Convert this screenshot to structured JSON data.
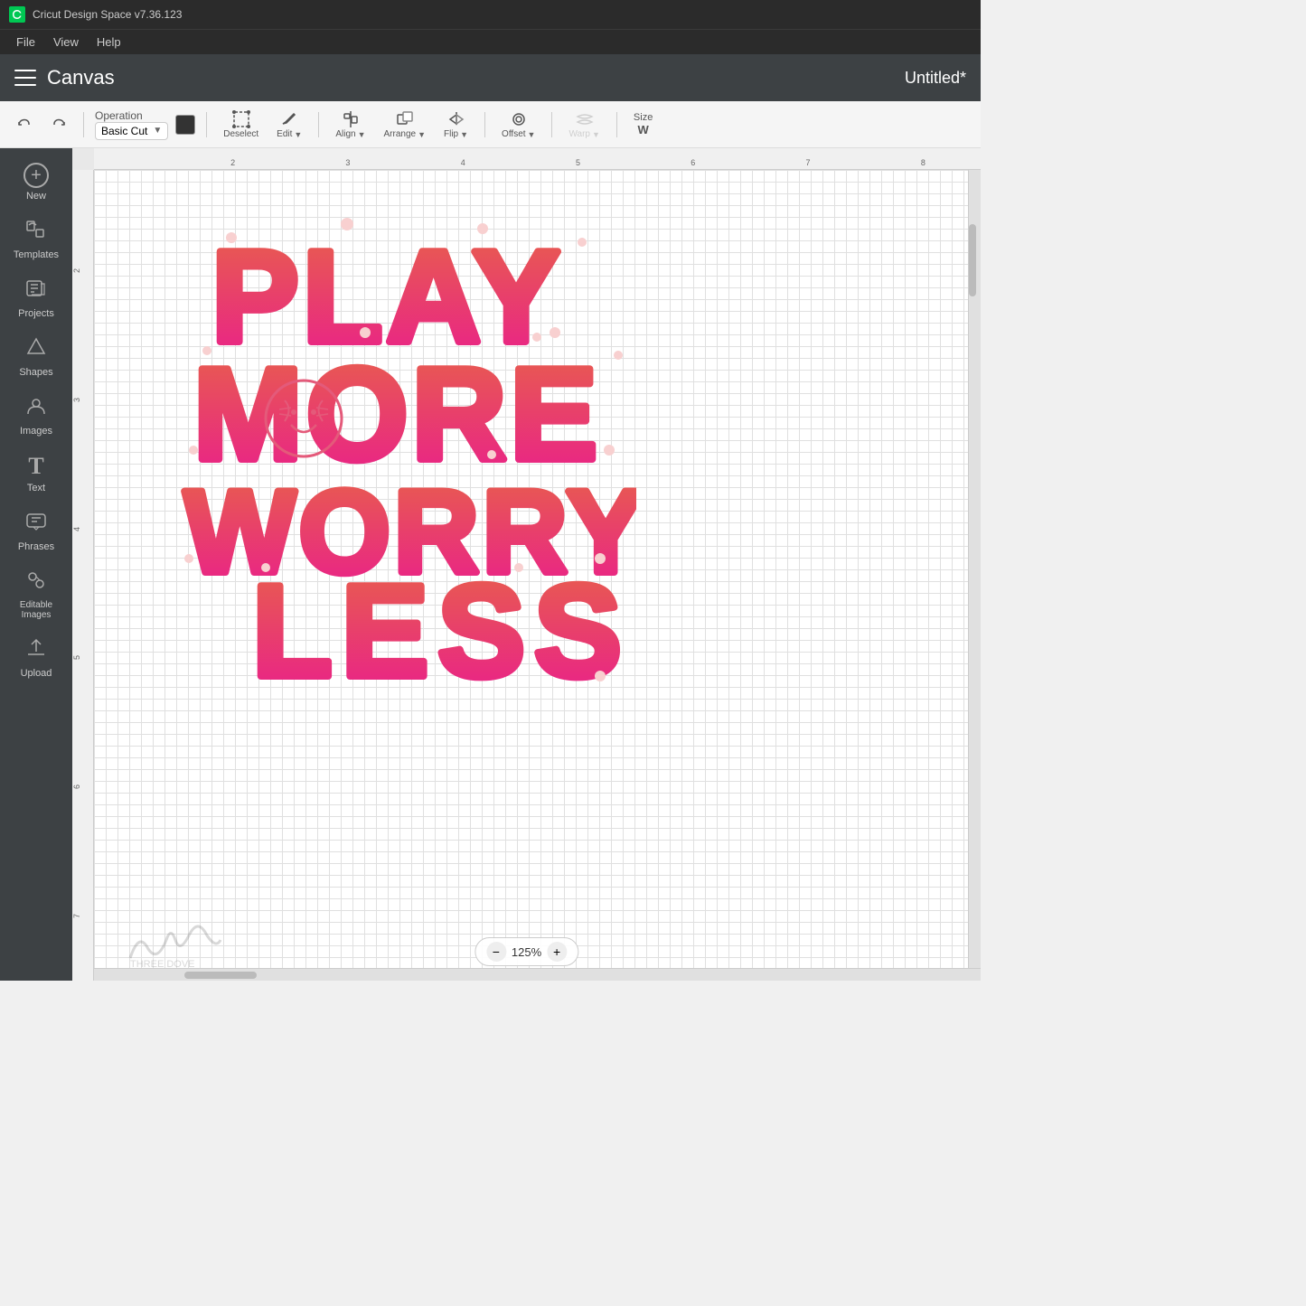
{
  "app": {
    "title": "Cricut Design Space  v7.36.123",
    "logo_text": "C"
  },
  "menu": {
    "items": [
      "File",
      "View",
      "Help"
    ]
  },
  "navbar": {
    "title": "Canvas",
    "doc_title": "Untitled*",
    "hamburger_label": "menu"
  },
  "toolbar": {
    "undo_label": "undo",
    "redo_label": "redo",
    "operation_label": "Operation",
    "operation_value": "Basic Cut",
    "deselect_label": "Deselect",
    "edit_label": "Edit",
    "align_label": "Align",
    "arrange_label": "Arrange",
    "flip_label": "Flip",
    "offset_label": "Offset",
    "warp_label": "Warp",
    "size_label": "Size",
    "size_short": "W"
  },
  "sidebar": {
    "items": [
      {
        "icon": "➕",
        "label": "New"
      },
      {
        "icon": "👕",
        "label": "Templates"
      },
      {
        "icon": "📋",
        "label": "Projects"
      },
      {
        "icon": "△",
        "label": "Shapes"
      },
      {
        "icon": "💡",
        "label": "Images"
      },
      {
        "icon": "T",
        "label": "Text"
      },
      {
        "icon": "💬",
        "label": "Phrases"
      },
      {
        "icon": "✂️",
        "label": "Editable Images"
      },
      {
        "icon": "⬆",
        "label": "Upload"
      }
    ]
  },
  "ruler": {
    "h_ticks": [
      "2",
      "3",
      "4",
      "5",
      "6",
      "7",
      "8"
    ],
    "v_ticks": [
      "2",
      "3",
      "4",
      "5",
      "6",
      "7"
    ]
  },
  "zoom": {
    "level": "125%",
    "minus_label": "−",
    "plus_label": "+"
  },
  "canvas": {
    "bg": "#ffffff"
  },
  "design": {
    "text": "PLAY MORE WORRY LESS",
    "gradient_start": "#e8614a",
    "gradient_end": "#e91e8c"
  }
}
